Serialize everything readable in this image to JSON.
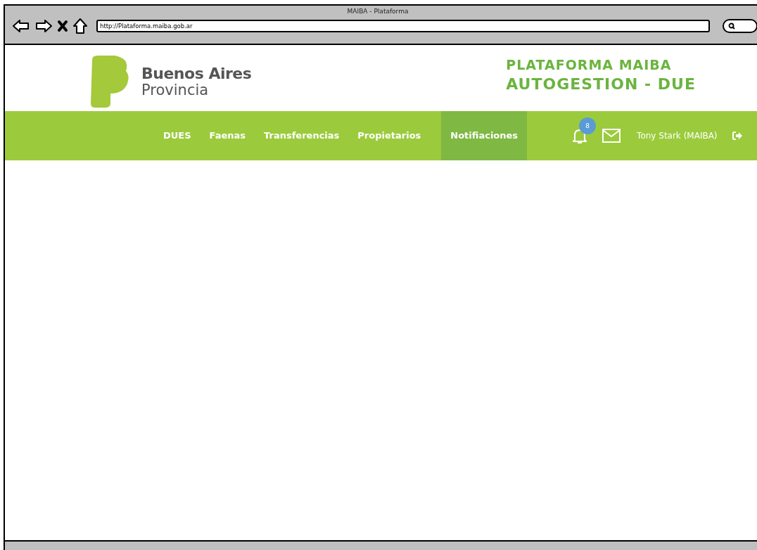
{
  "window": {
    "title": "MAIBA - Plataforma",
    "url": "http://Plataforma.maiba.gob.ar"
  },
  "brand": {
    "line1": "Buenos Aires",
    "line2": "Provincia"
  },
  "title": {
    "line1": "PLATAFORMA MAIBA",
    "line2": "AUTOGESTION - DUE"
  },
  "nav": [
    {
      "label": "DUES",
      "selected": false
    },
    {
      "label": "Faenas",
      "selected": false
    },
    {
      "label": "Transferencias",
      "selected": false
    },
    {
      "label": "Propietarios",
      "selected": false
    },
    {
      "label": "Notifiaciones",
      "selected": true
    }
  ],
  "notifications": {
    "count": "8"
  },
  "user": {
    "name": "Tony Stark (MAIBA)"
  }
}
